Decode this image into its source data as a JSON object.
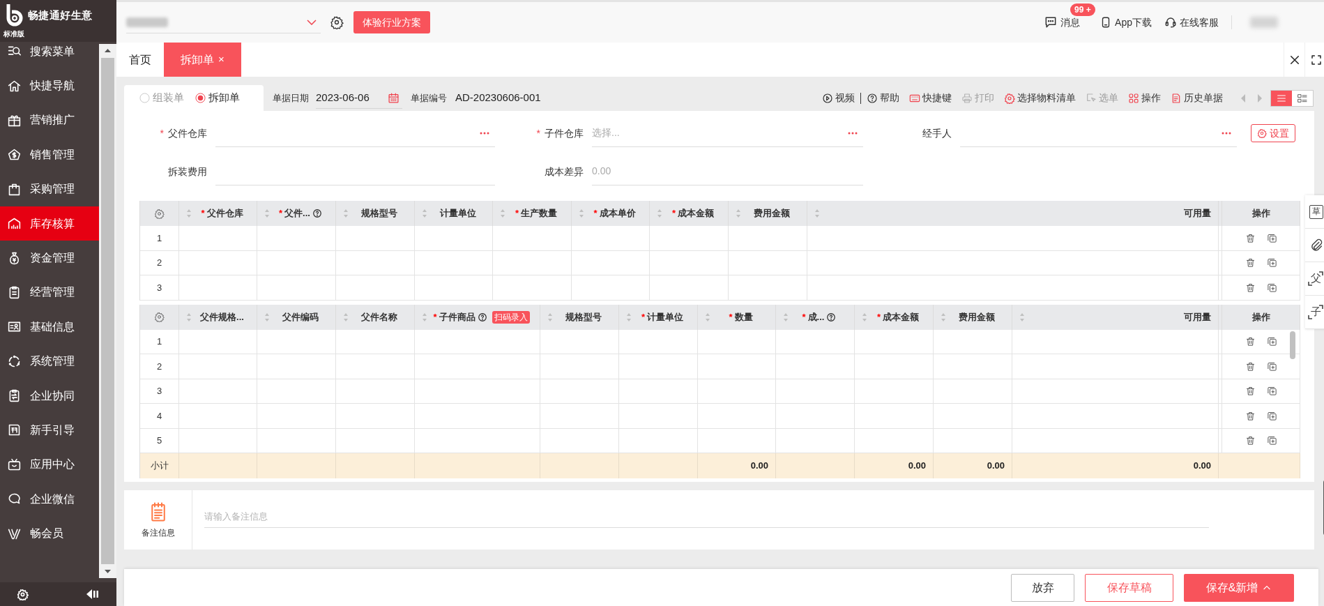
{
  "app": {
    "name": "畅捷通好生意",
    "edition": "标准版"
  },
  "sidebar": {
    "items": [
      {
        "label": "搜索菜单",
        "selected": false
      },
      {
        "label": "快捷导航",
        "selected": false
      },
      {
        "label": "营销推广",
        "selected": false
      },
      {
        "label": "销售管理",
        "selected": false
      },
      {
        "label": "采购管理",
        "selected": false
      },
      {
        "label": "库存核算",
        "selected": true
      },
      {
        "label": "资金管理",
        "selected": false
      },
      {
        "label": "经营管理",
        "selected": false
      },
      {
        "label": "基础信息",
        "selected": false
      },
      {
        "label": "系统管理",
        "selected": false
      },
      {
        "label": "企业协同",
        "selected": false
      },
      {
        "label": "新手引导",
        "selected": false
      },
      {
        "label": "应用中心",
        "selected": false
      },
      {
        "label": "企业微信",
        "selected": false
      },
      {
        "label": "畅会员",
        "selected": false
      }
    ]
  },
  "topbar": {
    "trial_button": "体验行业方案",
    "messages": {
      "label": "消息",
      "badge": "99 +"
    },
    "app_download": "App下载",
    "support": "在线客服"
  },
  "tabs": [
    {
      "label": "首页",
      "selected": false
    },
    {
      "label": "拆卸单",
      "selected": true,
      "close": "×"
    }
  ],
  "doc_types": [
    {
      "label": "组装单",
      "selected": false
    },
    {
      "label": "拆卸单",
      "selected": true
    }
  ],
  "date": {
    "label": "单据日期",
    "value": "2023-06-06"
  },
  "number": {
    "label": "单据编号",
    "value": "AD-20230606-001"
  },
  "toolbar": [
    {
      "kind": "video",
      "label": "视频",
      "disabled": false
    },
    {
      "kind": "help",
      "label": "帮助",
      "disabled": false
    },
    {
      "kind": "shortcut",
      "label": "快捷键",
      "disabled": false
    },
    {
      "kind": "print",
      "label": "打印",
      "disabled": true
    },
    {
      "kind": "bom",
      "label": "选择物料清单",
      "disabled": false
    },
    {
      "kind": "pick",
      "label": "选单",
      "disabled": true
    },
    {
      "kind": "actions",
      "label": "操作",
      "disabled": false
    },
    {
      "kind": "history",
      "label": "历史单据",
      "disabled": false
    }
  ],
  "view_modes": [
    {
      "kind": "list",
      "selected": true
    },
    {
      "kind": "detail",
      "selected": false
    }
  ],
  "form_fields": [
    {
      "label": "父件仓库",
      "mark": "*",
      "kind": "picker"
    },
    {
      "label": "子件仓库",
      "mark": "*",
      "kind": "picker",
      "placeholder": "选择..."
    },
    {
      "label": "经手人",
      "kind": "picker"
    },
    {
      "label": "拆装费用",
      "kind": "text"
    },
    {
      "label": "成本差异",
      "kind": "text",
      "placeholder": "0.00"
    }
  ],
  "settings_button": "设置",
  "parent_table": {
    "columns": [
      {
        "label": "父件仓库",
        "mark": "*",
        "sortable": true,
        "help": false
      },
      {
        "label": "父件...",
        "mark": "*",
        "sortable": true,
        "help": true
      },
      {
        "label": "规格型号",
        "sortable": true,
        "help": false
      },
      {
        "label": "计量单位",
        "sortable": true,
        "help": false
      },
      {
        "label": "生产数量",
        "mark": "*",
        "sortable": true,
        "help": false
      },
      {
        "label": "成本单价",
        "mark": "*",
        "sortable": true,
        "help": false
      },
      {
        "label": "成本金额",
        "mark": "*",
        "sortable": true,
        "help": false
      },
      {
        "label": "费用金额",
        "sortable": true,
        "help": false
      },
      {
        "label": "可用量",
        "sortable": true,
        "help": false
      },
      {
        "label": "操作",
        "sortable": false,
        "help": false
      }
    ],
    "rows": [
      "1",
      "2",
      "3"
    ]
  },
  "child_table": {
    "columns": [
      {
        "label": "父件规格...",
        "sortable": true,
        "help": false
      },
      {
        "label": "父件编码",
        "sortable": true,
        "help": false
      },
      {
        "label": "父件名称",
        "sortable": true,
        "help": false
      },
      {
        "label": "子件商品",
        "mark": "*",
        "sortable": true,
        "help": true,
        "badge": "扫码录入"
      },
      {
        "label": "规格型号",
        "sortable": true,
        "help": false
      },
      {
        "label": "计量单位",
        "mark": "*",
        "sortable": true,
        "help": false
      },
      {
        "label": "数量",
        "mark": "*",
        "sortable": true,
        "help": false,
        "subtotal": "0.00"
      },
      {
        "label": "成...",
        "mark": "*",
        "sortable": true,
        "help": true
      },
      {
        "label": "成本金额",
        "mark": "*",
        "sortable": true,
        "help": false,
        "subtotal": "0.00"
      },
      {
        "label": "费用金额",
        "sortable": true,
        "help": false,
        "subtotal": "0.00"
      },
      {
        "label": "可用量",
        "sortable": true,
        "help": false,
        "subtotal": "0.00"
      },
      {
        "label": "操作",
        "sortable": false,
        "help": false
      }
    ],
    "rows": [
      "1",
      "2",
      "3",
      "4",
      "5"
    ],
    "subtotal_label": "小计"
  },
  "side_tools": [
    {
      "kind": "draft",
      "glyph": "草"
    },
    {
      "kind": "attach"
    },
    {
      "kind": "scan",
      "glyph": "父"
    },
    {
      "kind": "scan",
      "glyph": "子"
    }
  ],
  "notes": {
    "label": "备注信息",
    "placeholder": "请输入备注信息"
  },
  "buttons": [
    {
      "label": "放弃",
      "kind": "plain"
    },
    {
      "label": "保存草稿",
      "kind": "outline"
    },
    {
      "label": "保存&新增",
      "kind": "primary"
    }
  ]
}
